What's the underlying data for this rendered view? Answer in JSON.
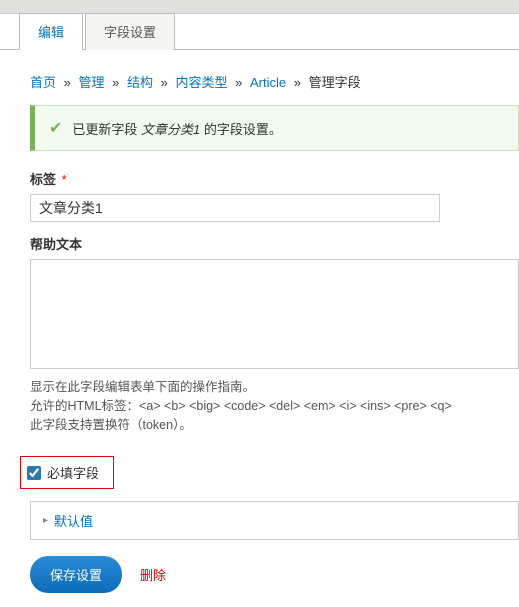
{
  "tabs": {
    "edit": "编辑",
    "field_settings": "字段设置"
  },
  "breadcrumb": {
    "home": "首页",
    "admin": "管理",
    "structure": "结构",
    "content_types": "内容类型",
    "article": "Article",
    "manage_fields": "管理字段",
    "sep": "»"
  },
  "status": {
    "prefix": "已更新字段 ",
    "field_name": "文章分类1",
    "suffix": " 的字段设置。"
  },
  "form": {
    "label_title": "标签",
    "label_value": "文章分类1",
    "help_title": "帮助文本",
    "help_value": "",
    "help_desc1": "显示在此字段编辑表单下面的操作指南。",
    "help_desc2": "允许的HTML标签：<a> <b> <big> <code> <del> <em> <i> <ins> <pre> <q>",
    "help_desc3": "此字段支持置换符（token）。",
    "required_label": "必填字段",
    "default_value": "默认值",
    "save": "保存设置",
    "delete": "删除",
    "required_marker": "*"
  }
}
